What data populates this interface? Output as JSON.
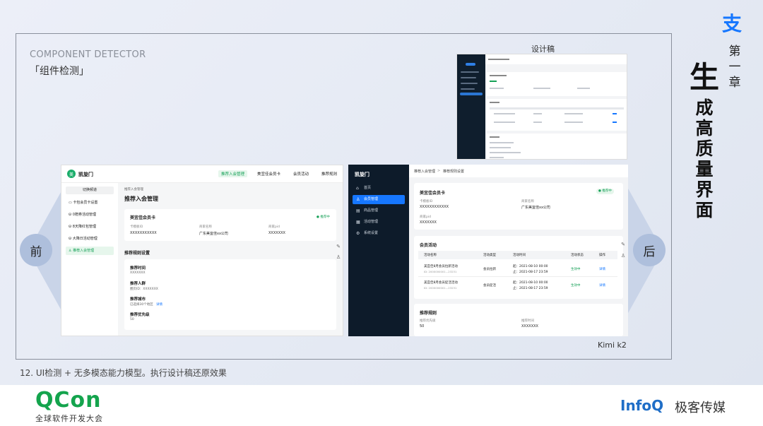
{
  "slide": {
    "section_en": "COMPONENT DETECTOR",
    "section_cn": "「组件检测」",
    "model_label": "Kimi k2",
    "caption": "12. UI检测 + 无多模态能力模型。执行设计稿还原效果",
    "chapter": "第一章",
    "title_first": "生",
    "title_rest": "成高质量界面",
    "before_label": "前",
    "after_label": "后",
    "design_label": "设计稿",
    "logo_glyph": "支"
  },
  "footer": {
    "qcon": "QCon",
    "qcon_sub": "全球软件开发大会",
    "infoq": "InfoQ",
    "infoq_cn": "极客传媒"
  },
  "colors": {
    "accent_green": "#17a158",
    "accent_blue": "#1677ff",
    "sidebar_dark": "#0d1b2a"
  },
  "before": {
    "brand": "凯旋门",
    "logo_char": "美",
    "tabs": [
      "推荐入会管理",
      "美宜佳会员卡",
      "会员活动",
      "推荐规则"
    ],
    "switch": "切换频道",
    "side_items": [
      "卡包会员卡设置",
      "0赠券活动管理",
      "8天降红包管理",
      "大降日活动管理",
      "推荐入会管理"
    ],
    "crumb": "推荐入会管理",
    "page_title": "推荐入会管理",
    "card": {
      "title": "美宜佳会员卡",
      "status": "● 推荐中",
      "fields": [
        {
          "label": "卡模板ID",
          "value": "XXXXXXXXXXX"
        },
        {
          "label": "商家名称",
          "value": "广东美宜佳xx公司"
        },
        {
          "label": "商家pid",
          "value": "XXXXXXX"
        }
      ]
    },
    "rules_title": "推荐规则设置",
    "rules": [
      {
        "label": "推荐时间",
        "value": "XXXXXXX"
      },
      {
        "label": "推荐人群",
        "value": "圈页ID：XXXXXXX"
      },
      {
        "label": "推荐城市",
        "value": "已选择30个地区",
        "link": "详情"
      },
      {
        "label": "推荐优先级",
        "value": "50"
      }
    ]
  },
  "after": {
    "brand": "凯旋门",
    "menu": [
      {
        "icon": "home-icon",
        "glyph": "⌂",
        "label": "首页"
      },
      {
        "icon": "users-icon",
        "glyph": "♙",
        "label": "会员管理"
      },
      {
        "icon": "goods-icon",
        "glyph": "▤",
        "label": "商品管理"
      },
      {
        "icon": "activity-icon",
        "glyph": "▦",
        "label": "活动管理"
      },
      {
        "icon": "settings-icon",
        "glyph": "⚙",
        "label": "系统设置"
      }
    ],
    "crumb1": "推荐入会管理",
    "crumb_sep": ">",
    "crumb2": "推荐规则设置",
    "card": {
      "title": "美宜佳会员卡",
      "status": "● 推荐中",
      "fields": [
        {
          "label": "卡模板ID",
          "value": "XXXXXXXXXXXX"
        },
        {
          "label": "商家名称",
          "value": "广东美宜佳xx公司"
        },
        {
          "label": "商家pid",
          "value": "XXXXXXX"
        }
      ]
    },
    "activities": {
      "title": "会员活动",
      "headers": [
        "活动名称",
        "活动类型",
        "活动时间",
        "活动状态",
        "操作"
      ],
      "rows": [
        {
          "name": "美宜佳8月会员拉新活动",
          "id": "ID: 2000000001...23231",
          "type": "会员拉新",
          "start": "起：2021-08-10 00:00",
          "end": "止：2021-08-17 23:59",
          "status": "生效中",
          "op": "详情"
        },
        {
          "name": "美宜佳8月会员促活活动",
          "id": "ID: 2000000001...23231",
          "type": "会员促活",
          "start": "起：2021-08-10 00:00",
          "end": "止：2021-08-17 23:59",
          "status": "生效中",
          "op": "详情"
        }
      ]
    },
    "rules": {
      "title": "推荐规则",
      "fields": [
        {
          "label": "推荐优先级",
          "value": "50"
        },
        {
          "label": "推荐时间",
          "value": "XXXXXXX"
        }
      ]
    }
  }
}
